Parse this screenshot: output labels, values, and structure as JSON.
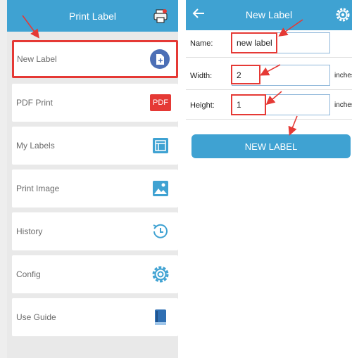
{
  "main_menu": {
    "title": "Print Label",
    "items": [
      {
        "label": "New Label",
        "icon": "new-document-icon"
      },
      {
        "label": "PDF Print",
        "icon": "pdf-icon",
        "icon_text": "PDF"
      },
      {
        "label": "My Labels",
        "icon": "label-template-icon"
      },
      {
        "label": "Print Image",
        "icon": "image-icon"
      },
      {
        "label": "History",
        "icon": "history-clock-icon"
      },
      {
        "label": "Config",
        "icon": "gear-icon"
      },
      {
        "label": "Use Guide",
        "icon": "guide-book-icon"
      }
    ]
  },
  "new_label": {
    "title": "New Label",
    "name_label": "Name:",
    "name_value": "new label",
    "width_label": "Width:",
    "width_value": "2",
    "width_unit": "inches",
    "height_label": "Height:",
    "height_value": "1",
    "height_unit": "inches",
    "create_button": "NEW LABEL"
  },
  "colors": {
    "header": "#3fa2d2",
    "highlight": "#e53935",
    "pdf_red": "#e53935",
    "icon_blue": "#3fa2d2",
    "new_label_icon": "#4c6fb6"
  }
}
